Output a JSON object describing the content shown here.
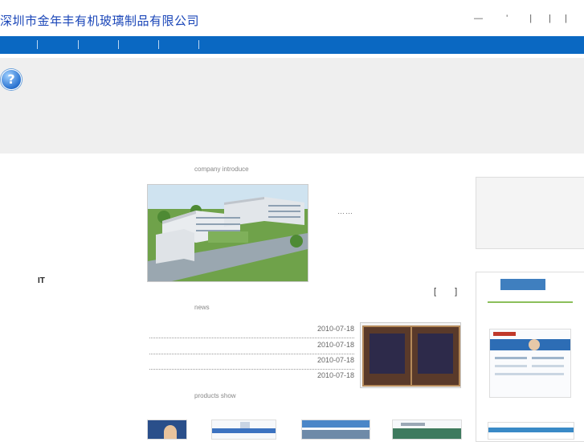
{
  "header": {
    "site_title": "深圳市金年丰有机玻璃制品有限公司",
    "top_links": [
      "—",
      "'",
      "|",
      "|",
      "|"
    ]
  },
  "colors": {
    "nav_bar": "#0a68c2",
    "title_blue": "#1a46b8",
    "band_gray": "#efefef"
  },
  "icons": [
    "help-icon"
  ],
  "sections": {
    "company_label": "company introduce",
    "ellipsis": "……",
    "side_text": "IT",
    "more_bracket": "[ ]",
    "news_label": "news",
    "products_label": "products show"
  },
  "news": [
    {
      "date": "2010-07-18"
    },
    {
      "date": "2010-07-18"
    },
    {
      "date": "2010-07-18"
    },
    {
      "date": "2010-07-18"
    }
  ]
}
